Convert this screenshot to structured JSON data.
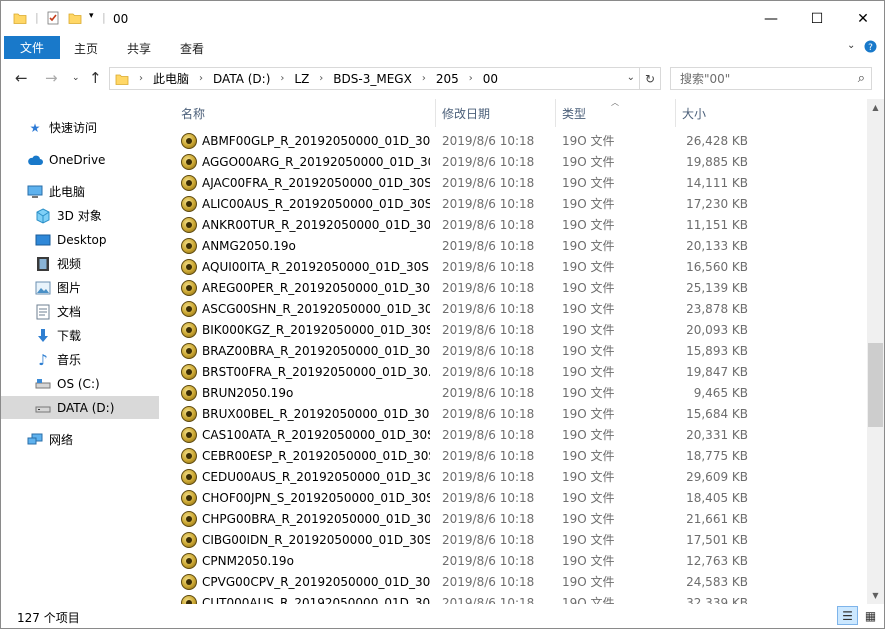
{
  "window": {
    "title": "00",
    "minimize": "—",
    "maximize": "☐",
    "close": "✕"
  },
  "ribbon": {
    "file_tab": "文件",
    "tabs": [
      "主页",
      "共享",
      "查看"
    ],
    "collapse_icon": "chevron-down-icon",
    "help_icon": "help-icon"
  },
  "address": {
    "crumbs": [
      "此电脑",
      "DATA (D:)",
      "LZ",
      "BDS-3_MEGX",
      "205",
      "00"
    ],
    "search_placeholder": "搜索\"00\""
  },
  "nav": [
    {
      "label": "快速访问",
      "icon": "star-icon"
    },
    {
      "label": "OneDrive",
      "icon": "cloud-icon"
    },
    {
      "label": "此电脑",
      "icon": "computer-icon"
    },
    {
      "label": "3D 对象",
      "icon": "3d-objects-icon"
    },
    {
      "label": "Desktop",
      "icon": "desktop-icon"
    },
    {
      "label": "视频",
      "icon": "video-icon"
    },
    {
      "label": "图片",
      "icon": "picture-icon"
    },
    {
      "label": "文档",
      "icon": "document-icon"
    },
    {
      "label": "下载",
      "icon": "download-icon"
    },
    {
      "label": "音乐",
      "icon": "music-icon"
    },
    {
      "label": "OS (C:)",
      "icon": "drive-icon"
    },
    {
      "label": "DATA (D:)",
      "icon": "drive-icon"
    },
    {
      "label": "网络",
      "icon": "network-icon"
    }
  ],
  "columns": {
    "name": "名称",
    "date": "修改日期",
    "type": "类型",
    "size": "大小"
  },
  "files": [
    {
      "name": "ABMF00GLP_R_20192050000_01D_30...",
      "date": "2019/8/6 10:18",
      "type": "19O 文件",
      "size": "26,428 KB"
    },
    {
      "name": "AGGO00ARG_R_20192050000_01D_30...",
      "date": "2019/8/6 10:18",
      "type": "19O 文件",
      "size": "19,885 KB"
    },
    {
      "name": "AJAC00FRA_R_20192050000_01D_30S...",
      "date": "2019/8/6 10:18",
      "type": "19O 文件",
      "size": "14,111 KB"
    },
    {
      "name": "ALIC00AUS_R_20192050000_01D_30S...",
      "date": "2019/8/6 10:18",
      "type": "19O 文件",
      "size": "17,230 KB"
    },
    {
      "name": "ANKR00TUR_R_20192050000_01D_30...",
      "date": "2019/8/6 10:18",
      "type": "19O 文件",
      "size": "11,151 KB"
    },
    {
      "name": "ANMG2050.19o",
      "date": "2019/8/6 10:18",
      "type": "19O 文件",
      "size": "20,133 KB"
    },
    {
      "name": "AQUI00ITA_R_20192050000_01D_30S...",
      "date": "2019/8/6 10:18",
      "type": "19O 文件",
      "size": "16,560 KB"
    },
    {
      "name": "AREG00PER_R_20192050000_01D_30S...",
      "date": "2019/8/6 10:18",
      "type": "19O 文件",
      "size": "25,139 KB"
    },
    {
      "name": "ASCG00SHN_R_20192050000_01D_30S...",
      "date": "2019/8/6 10:18",
      "type": "19O 文件",
      "size": "23,878 KB"
    },
    {
      "name": "BIK000KGZ_R_20192050000_01D_30S...",
      "date": "2019/8/6 10:18",
      "type": "19O 文件",
      "size": "20,093 KB"
    },
    {
      "name": "BRAZ00BRA_R_20192050000_01D_30...",
      "date": "2019/8/6 10:18",
      "type": "19O 文件",
      "size": "15,893 KB"
    },
    {
      "name": "BRST00FRA_R_20192050000_01D_30...",
      "date": "2019/8/6 10:18",
      "type": "19O 文件",
      "size": "19,847 KB"
    },
    {
      "name": "BRUN2050.19o",
      "date": "2019/8/6 10:18",
      "type": "19O 文件",
      "size": "9,465 KB"
    },
    {
      "name": "BRUX00BEL_R_20192050000_01D_30S...",
      "date": "2019/8/6 10:18",
      "type": "19O 文件",
      "size": "15,684 KB"
    },
    {
      "name": "CAS100ATA_R_20192050000_01D_30S...",
      "date": "2019/8/6 10:18",
      "type": "19O 文件",
      "size": "20,331 KB"
    },
    {
      "name": "CEBR00ESP_R_20192050000_01D_30S...",
      "date": "2019/8/6 10:18",
      "type": "19O 文件",
      "size": "18,775 KB"
    },
    {
      "name": "CEDU00AUS_R_20192050000_01D_30...",
      "date": "2019/8/6 10:18",
      "type": "19O 文件",
      "size": "29,609 KB"
    },
    {
      "name": "CHOF00JPN_S_20192050000_01D_30S...",
      "date": "2019/8/6 10:18",
      "type": "19O 文件",
      "size": "18,405 KB"
    },
    {
      "name": "CHPG00BRA_R_20192050000_01D_30...",
      "date": "2019/8/6 10:18",
      "type": "19O 文件",
      "size": "21,661 KB"
    },
    {
      "name": "CIBG00IDN_R_20192050000_01D_30S...",
      "date": "2019/8/6 10:18",
      "type": "19O 文件",
      "size": "17,501 KB"
    },
    {
      "name": "CPNM2050.19o",
      "date": "2019/8/6 10:18",
      "type": "19O 文件",
      "size": "12,763 KB"
    },
    {
      "name": "CPVG00CPV_R_20192050000_01D_30...",
      "date": "2019/8/6 10:18",
      "type": "19O 文件",
      "size": "24,583 KB"
    },
    {
      "name": "CUT000AUS_R_20192050000_01D_30...",
      "date": "2019/8/6 10:18",
      "type": "19O 文件",
      "size": "32,339 KB"
    }
  ],
  "status": {
    "item_count": "127 个项目"
  },
  "colors": {
    "accent": "#1979ca",
    "selected_nav": "#d9d9d9"
  }
}
